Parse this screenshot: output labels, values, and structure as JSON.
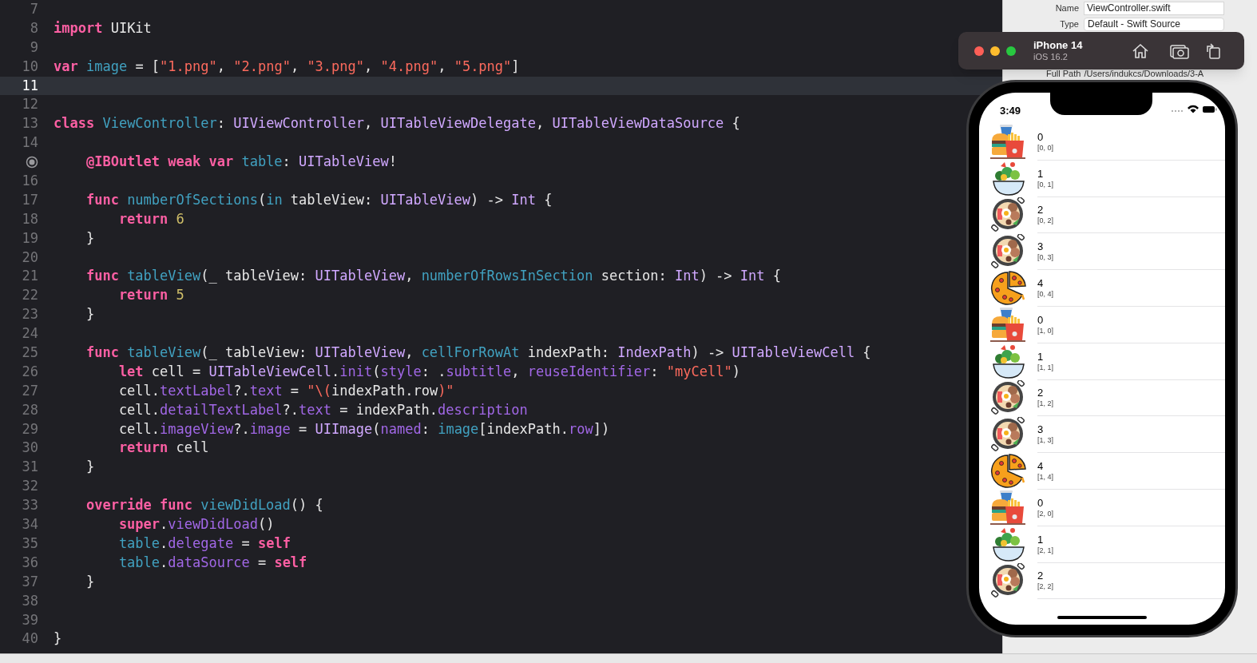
{
  "editor": {
    "lines": [
      {
        "number": "7"
      },
      {
        "number": "8",
        "tokens": [
          {
            "kind": "keyword",
            "text": "import"
          },
          {
            "kind": "plain",
            "text": " UIKit"
          }
        ]
      },
      {
        "number": "9"
      },
      {
        "number": "10",
        "tokens": [
          {
            "kind": "keyword",
            "text": "var"
          },
          {
            "kind": "ident",
            "text": " image"
          },
          {
            "kind": "plain",
            "text": " = ["
          },
          {
            "kind": "string",
            "text": "\"1.png\""
          },
          {
            "kind": "plain",
            "text": ", "
          },
          {
            "kind": "string",
            "text": "\"2.png\""
          },
          {
            "kind": "plain",
            "text": ", "
          },
          {
            "kind": "string",
            "text": "\"3.png\""
          },
          {
            "kind": "plain",
            "text": ", "
          },
          {
            "kind": "string",
            "text": "\"4.png\""
          },
          {
            "kind": "plain",
            "text": ", "
          },
          {
            "kind": "string",
            "text": "\"5.png\""
          },
          {
            "kind": "plain",
            "text": "]"
          }
        ]
      },
      {
        "number": "11",
        "current": true
      },
      {
        "number": "12"
      },
      {
        "number": "13",
        "tokens": [
          {
            "kind": "keyword",
            "text": "class"
          },
          {
            "kind": "decl",
            "text": " ViewController"
          },
          {
            "kind": "plain",
            "text": ": "
          },
          {
            "kind": "type",
            "text": "UIViewController"
          },
          {
            "kind": "plain",
            "text": ", "
          },
          {
            "kind": "type",
            "text": "UITableViewDelegate"
          },
          {
            "kind": "plain",
            "text": ", "
          },
          {
            "kind": "type",
            "text": "UITableViewDataSource"
          },
          {
            "kind": "plain",
            "text": " {"
          }
        ]
      },
      {
        "number": "14"
      },
      {
        "outlet_marker": true,
        "tokens": [
          {
            "kind": "keyword",
            "text": "    @IBOutlet weak var"
          },
          {
            "kind": "decl",
            "text": " table"
          },
          {
            "kind": "plain",
            "text": ": "
          },
          {
            "kind": "type",
            "text": "UITableView"
          },
          {
            "kind": "plain",
            "text": "!"
          }
        ]
      },
      {
        "number": "16"
      },
      {
        "number": "17",
        "tokens": [
          {
            "kind": "keyword",
            "text": "    func"
          },
          {
            "kind": "decl",
            "text": " numberOfSections"
          },
          {
            "kind": "plain",
            "text": "("
          },
          {
            "kind": "decl",
            "text": "in"
          },
          {
            "kind": "plain",
            "text": " tableView: "
          },
          {
            "kind": "type",
            "text": "UITableView"
          },
          {
            "kind": "plain",
            "text": ") -> "
          },
          {
            "kind": "type",
            "text": "Int"
          },
          {
            "kind": "plain",
            "text": " {"
          }
        ]
      },
      {
        "number": "18",
        "tokens": [
          {
            "kind": "keyword",
            "text": "        return"
          },
          {
            "kind": "number",
            "text": " 6"
          }
        ]
      },
      {
        "number": "19",
        "tokens": [
          {
            "kind": "plain",
            "text": "    }"
          }
        ]
      },
      {
        "number": "20"
      },
      {
        "number": "21",
        "tokens": [
          {
            "kind": "keyword",
            "text": "    func"
          },
          {
            "kind": "decl",
            "text": " tableView"
          },
          {
            "kind": "plain",
            "text": "(_ tableView: "
          },
          {
            "kind": "type",
            "text": "UITableView"
          },
          {
            "kind": "plain",
            "text": ", "
          },
          {
            "kind": "decl",
            "text": "numberOfRowsInSection"
          },
          {
            "kind": "plain",
            "text": " section: "
          },
          {
            "kind": "type",
            "text": "Int"
          },
          {
            "kind": "plain",
            "text": ") -> "
          },
          {
            "kind": "type",
            "text": "Int"
          },
          {
            "kind": "plain",
            "text": " {"
          }
        ]
      },
      {
        "number": "22",
        "tokens": [
          {
            "kind": "keyword",
            "text": "        return"
          },
          {
            "kind": "number",
            "text": " 5"
          }
        ]
      },
      {
        "number": "23",
        "tokens": [
          {
            "kind": "plain",
            "text": "    }"
          }
        ]
      },
      {
        "number": "24"
      },
      {
        "number": "25",
        "tokens": [
          {
            "kind": "keyword",
            "text": "    func"
          },
          {
            "kind": "decl",
            "text": " tableView"
          },
          {
            "kind": "plain",
            "text": "(_ tableView: "
          },
          {
            "kind": "type",
            "text": "UITableView"
          },
          {
            "kind": "plain",
            "text": ", "
          },
          {
            "kind": "decl",
            "text": "cellForRowAt"
          },
          {
            "kind": "plain",
            "text": " indexPath: "
          },
          {
            "kind": "type",
            "text": "IndexPath"
          },
          {
            "kind": "plain",
            "text": ") -> "
          },
          {
            "kind": "type",
            "text": "UITableViewCell"
          },
          {
            "kind": "plain",
            "text": " {"
          }
        ]
      },
      {
        "number": "26",
        "tokens": [
          {
            "kind": "keyword",
            "text": "        let"
          },
          {
            "kind": "plain",
            "text": " cell = "
          },
          {
            "kind": "type",
            "text": "UITableViewCell"
          },
          {
            "kind": "plain",
            "text": "."
          },
          {
            "kind": "prop",
            "text": "init"
          },
          {
            "kind": "plain",
            "text": "("
          },
          {
            "kind": "prop",
            "text": "style"
          },
          {
            "kind": "plain",
            "text": ": ."
          },
          {
            "kind": "prop",
            "text": "subtitle"
          },
          {
            "kind": "plain",
            "text": ", "
          },
          {
            "kind": "prop",
            "text": "reuseIdentifier"
          },
          {
            "kind": "plain",
            "text": ": "
          },
          {
            "kind": "string",
            "text": "\"myCell\""
          },
          {
            "kind": "plain",
            "text": ")"
          }
        ]
      },
      {
        "number": "27",
        "tokens": [
          {
            "kind": "plain",
            "text": "        cell."
          },
          {
            "kind": "prop",
            "text": "textLabel"
          },
          {
            "kind": "plain",
            "text": "?."
          },
          {
            "kind": "prop",
            "text": "text"
          },
          {
            "kind": "plain",
            "text": " = "
          },
          {
            "kind": "string",
            "text": "\"\\("
          },
          {
            "kind": "plain",
            "text": "indexPath.row"
          },
          {
            "kind": "string",
            "text": ")\""
          }
        ]
      },
      {
        "number": "28",
        "tokens": [
          {
            "kind": "plain",
            "text": "        cell."
          },
          {
            "kind": "prop",
            "text": "detailTextLabel"
          },
          {
            "kind": "plain",
            "text": "?."
          },
          {
            "kind": "prop",
            "text": "text"
          },
          {
            "kind": "plain",
            "text": " = indexPath."
          },
          {
            "kind": "prop",
            "text": "description"
          }
        ]
      },
      {
        "number": "29",
        "tokens": [
          {
            "kind": "plain",
            "text": "        cell."
          },
          {
            "kind": "prop",
            "text": "imageView"
          },
          {
            "kind": "plain",
            "text": "?."
          },
          {
            "kind": "prop",
            "text": "image"
          },
          {
            "kind": "plain",
            "text": " = "
          },
          {
            "kind": "type",
            "text": "UIImage"
          },
          {
            "kind": "plain",
            "text": "("
          },
          {
            "kind": "prop",
            "text": "named"
          },
          {
            "kind": "plain",
            "text": ": "
          },
          {
            "kind": "ident",
            "text": "image"
          },
          {
            "kind": "plain",
            "text": "[indexPath."
          },
          {
            "kind": "prop",
            "text": "row"
          },
          {
            "kind": "plain",
            "text": "])"
          }
        ]
      },
      {
        "number": "30",
        "tokens": [
          {
            "kind": "keyword",
            "text": "        return"
          },
          {
            "kind": "plain",
            "text": " cell"
          }
        ]
      },
      {
        "number": "31",
        "tokens": [
          {
            "kind": "plain",
            "text": "    }"
          }
        ]
      },
      {
        "number": "32"
      },
      {
        "number": "33",
        "tokens": [
          {
            "kind": "keyword",
            "text": "    override func"
          },
          {
            "kind": "decl",
            "text": " viewDidLoad"
          },
          {
            "kind": "plain",
            "text": "() {"
          }
        ]
      },
      {
        "number": "34",
        "tokens": [
          {
            "kind": "keyword",
            "text": "        super"
          },
          {
            "kind": "plain",
            "text": "."
          },
          {
            "kind": "prop",
            "text": "viewDidLoad"
          },
          {
            "kind": "plain",
            "text": "()"
          }
        ]
      },
      {
        "number": "35",
        "tokens": [
          {
            "kind": "ident",
            "text": "        table"
          },
          {
            "kind": "plain",
            "text": "."
          },
          {
            "kind": "prop",
            "text": "delegate"
          },
          {
            "kind": "plain",
            "text": " = "
          },
          {
            "kind": "keyword",
            "text": "self"
          }
        ]
      },
      {
        "number": "36",
        "tokens": [
          {
            "kind": "ident",
            "text": "        table"
          },
          {
            "kind": "plain",
            "text": "."
          },
          {
            "kind": "prop",
            "text": "dataSource"
          },
          {
            "kind": "plain",
            "text": " = "
          },
          {
            "kind": "keyword",
            "text": "self"
          }
        ]
      },
      {
        "number": "37",
        "tokens": [
          {
            "kind": "plain",
            "text": "    }"
          }
        ]
      },
      {
        "number": "38"
      },
      {
        "number": "39"
      },
      {
        "number": "40",
        "tokens": [
          {
            "kind": "plain",
            "text": "}"
          }
        ]
      }
    ]
  },
  "inspector": {
    "name_label": "Name",
    "name_value": "ViewController.swift",
    "type_label": "Type",
    "type_value": "Default - Swift Source",
    "path_label": "Full Path",
    "path_value": "/Users/indukcs/Downloads/3-A"
  },
  "simulator": {
    "device": "iPhone 14",
    "os": "iOS 16.2",
    "time": "3:49",
    "rows": [
      {
        "kind": "burger",
        "title": "0",
        "subtitle": "[0, 0]"
      },
      {
        "kind": "salad",
        "title": "1",
        "subtitle": "[0, 1]"
      },
      {
        "kind": "pan",
        "title": "2",
        "subtitle": "[0, 2]"
      },
      {
        "kind": "pan",
        "title": "3",
        "subtitle": "[0, 3]"
      },
      {
        "kind": "pizza",
        "title": "4",
        "subtitle": "[0, 4]"
      },
      {
        "kind": "burger",
        "title": "0",
        "subtitle": "[1, 0]"
      },
      {
        "kind": "salad",
        "title": "1",
        "subtitle": "[1, 1]"
      },
      {
        "kind": "pan",
        "title": "2",
        "subtitle": "[1, 2]"
      },
      {
        "kind": "pan",
        "title": "3",
        "subtitle": "[1, 3]"
      },
      {
        "kind": "pizza",
        "title": "4",
        "subtitle": "[1, 4]"
      },
      {
        "kind": "burger",
        "title": "0",
        "subtitle": "[2, 0]"
      },
      {
        "kind": "salad",
        "title": "1",
        "subtitle": "[2, 1]"
      },
      {
        "kind": "pan",
        "title": "2",
        "subtitle": "[2, 2]"
      }
    ]
  }
}
